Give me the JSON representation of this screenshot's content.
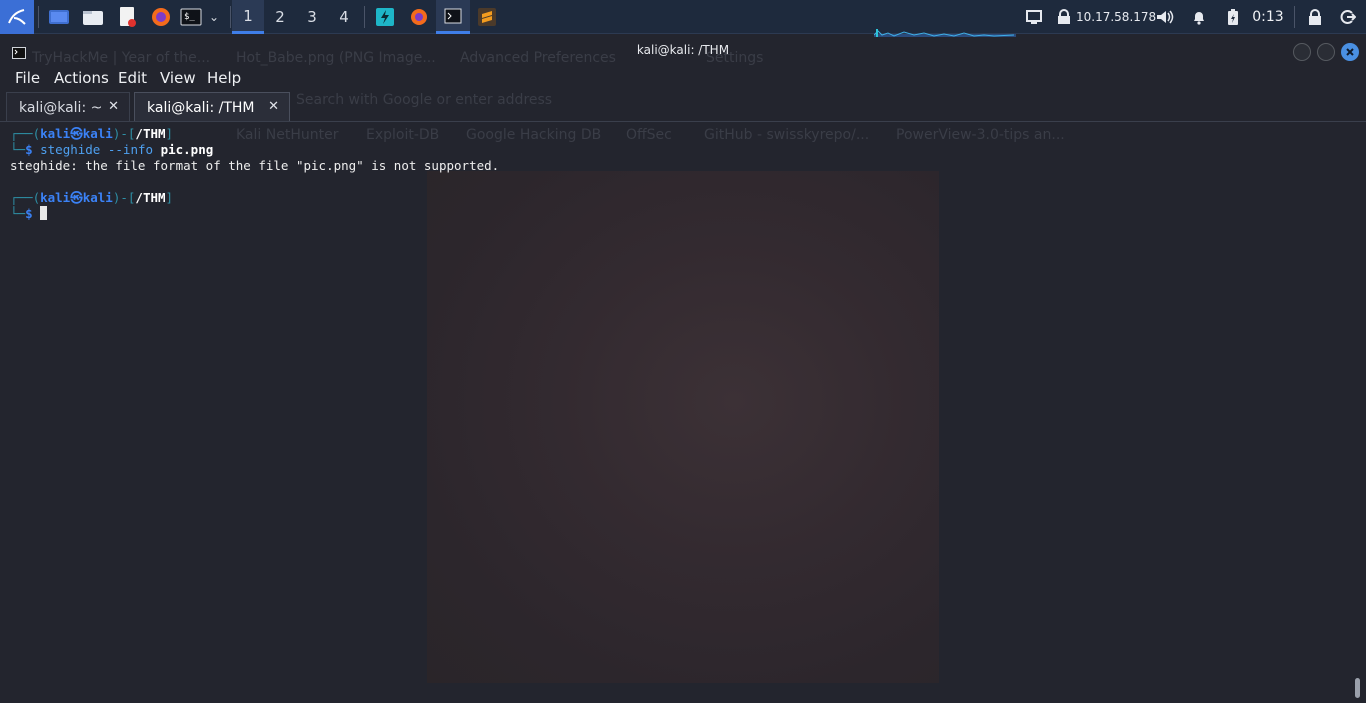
{
  "panel": {
    "workspaces": [
      "1",
      "2",
      "3",
      "4"
    ],
    "active_workspace": "1",
    "ip_address": "10.17.58.178",
    "clock": "0:13"
  },
  "background_window": {
    "tabs": [
      "TryHackMe | Year of the...",
      "Hot_Babe.png (PNG Image...",
      "Advanced Preferences",
      "Settings"
    ],
    "address_placeholder": "Search with Google or enter address",
    "bookmarks": [
      "Kali NetHunter",
      "Exploit-DB",
      "Google Hacking DB",
      "OffSec",
      "GitHub - swisskyrepo/...",
      "PowerView-3.0-tips an..."
    ]
  },
  "window": {
    "title": "kali@kali: /THM",
    "menu": [
      "File",
      "Actions",
      "Edit",
      "View",
      "Help"
    ],
    "tabs": [
      {
        "label": "kali@kali: ~",
        "close": "✕"
      },
      {
        "label": "kali@kali: /THM",
        "close": "✕"
      }
    ]
  },
  "terminal": {
    "prompt1": {
      "user": "kali",
      "sym": "㉿",
      "host": "kali",
      "dir": "/THM"
    },
    "command1": {
      "name": "steghide",
      "flag": "--info",
      "arg": "pic.png"
    },
    "output1": "steghide: the file format of the file \"pic.png\" is not supported.",
    "prompt2": {
      "user": "kali",
      "sym": "㉿",
      "host": "kali",
      "dir": "/THM"
    }
  },
  "colors": {
    "panel_bg": "#1e2a3d",
    "terminal_bg": "#23252e",
    "accent_blue": "#3b82f6",
    "frame_teal": "#2e8fa5",
    "close_button": "#4a90e2"
  }
}
